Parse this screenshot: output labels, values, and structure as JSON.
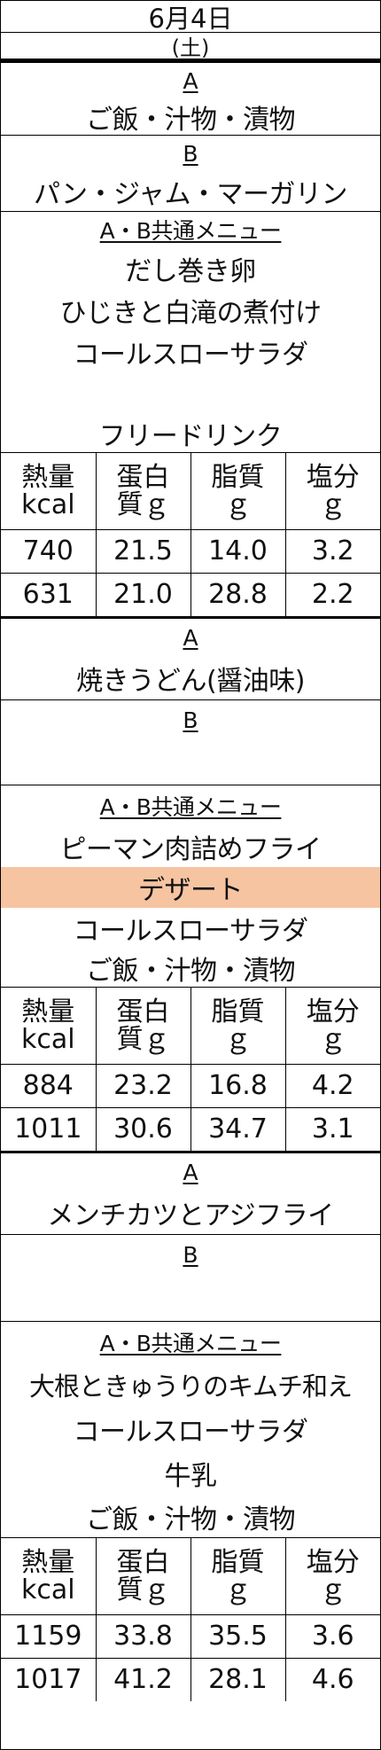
{
  "header": {
    "date": "6月4日",
    "day": "(土)"
  },
  "nutrition_headers": [
    {
      "line1": "熱量",
      "line2": "kcal"
    },
    {
      "line1": "蛋白",
      "line2": "質ｇ"
    },
    {
      "line1": "脂質",
      "line2": "ｇ"
    },
    {
      "line1": "塩分",
      "line2": "ｇ"
    }
  ],
  "meals": [
    {
      "a_label": "A",
      "a_dish": "ご飯・汁物・漬物",
      "b_label": "B",
      "b_dish": "パン・ジャム・マーガリン",
      "common_label": "A・B共通メニュー",
      "common_items": [
        "だし巻き卵",
        "ひじきと白滝の煮付け",
        "コールスローサラダ",
        "",
        "フリードリンク"
      ],
      "nutrition": [
        [
          "740",
          "21.5",
          "14.0",
          "3.2"
        ],
        [
          "631",
          "21.0",
          "28.8",
          "2.2"
        ]
      ]
    },
    {
      "a_label": "A",
      "a_dish": "焼きうどん(醤油味)",
      "b_label": "B",
      "b_dish": "",
      "common_label": "A・B共通メニュー",
      "common_items": [
        "ピーマン肉詰めフライ",
        "デザート",
        "コールスローサラダ",
        "ご飯・汁物・漬物"
      ],
      "highlight_item": "デザート",
      "nutrition": [
        [
          "884",
          "23.2",
          "16.8",
          "4.2"
        ],
        [
          "1011",
          "30.6",
          "34.7",
          "3.1"
        ]
      ]
    },
    {
      "a_label": "A",
      "a_dish": "メンチカツとアジフライ",
      "b_label": "B",
      "b_dish": "",
      "common_label": "A・B共通メニュー",
      "common_items": [
        "大根ときゅうりのキムチ和え",
        "コールスローサラダ",
        "牛乳",
        "ご飯・汁物・漬物"
      ],
      "nutrition": [
        [
          "1159",
          "33.8",
          "35.5",
          "3.6"
        ],
        [
          "1017",
          "41.2",
          "28.1",
          "4.6"
        ]
      ]
    }
  ],
  "colors": {
    "highlight": "#f6c4a1",
    "rule": "#000000"
  }
}
